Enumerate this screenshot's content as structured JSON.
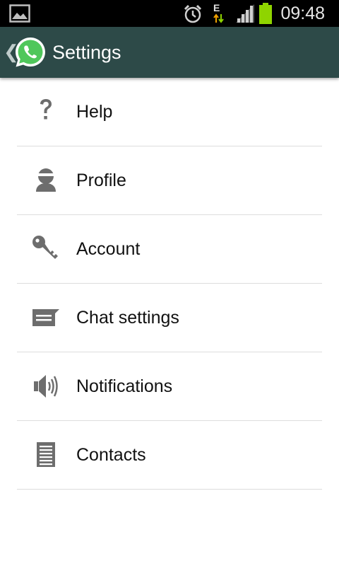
{
  "status_bar": {
    "time": "09:48",
    "network_type": "E",
    "icons": [
      "image-icon",
      "alarm-icon",
      "data-arrows-icon",
      "signal-icon",
      "battery-icon"
    ]
  },
  "action_bar": {
    "title": "Settings",
    "back_icon": "chevron-left-icon",
    "logo": "whatsapp-logo"
  },
  "colors": {
    "status_bar_bg": "#000000",
    "action_bar_bg": "#2d4a48",
    "logo_green": "#4fc75b",
    "battery_green": "#8fd400",
    "icon_gray": "#6d6d6d",
    "divider": "#dddddd"
  },
  "menu": {
    "items": [
      {
        "label": "Help",
        "icon": "help-icon"
      },
      {
        "label": "Profile",
        "icon": "profile-icon"
      },
      {
        "label": "Account",
        "icon": "key-icon"
      },
      {
        "label": "Chat settings",
        "icon": "chat-icon"
      },
      {
        "label": "Notifications",
        "icon": "speaker-icon"
      },
      {
        "label": "Contacts",
        "icon": "contacts-icon"
      }
    ]
  }
}
